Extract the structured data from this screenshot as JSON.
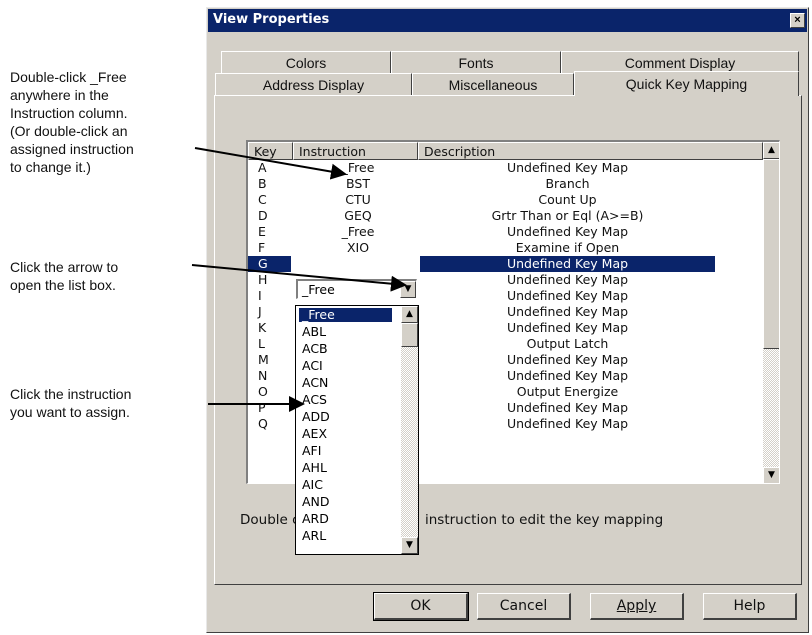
{
  "callouts": [
    {
      "lines": [
        "Double-click _Free",
        "anywhere in the",
        "Instruction column.",
        "(Or double-click an",
        "assigned instruction",
        "to change it.)"
      ]
    },
    {
      "lines": [
        "Click the arrow to",
        "open the list box."
      ]
    },
    {
      "lines": [
        "Click the instruction",
        "you want to assign."
      ]
    }
  ],
  "dialog": {
    "title": "View Properties",
    "close_label": "×",
    "tabs_back": [
      "Colors",
      "Fonts",
      "Comment Display"
    ],
    "tabs_front": [
      "Address Display",
      "Miscellaneous",
      "Quick Key Mapping"
    ],
    "active_tab": "Quick Key Mapping",
    "columns": [
      "Key",
      "Instruction",
      "Description"
    ],
    "rows": [
      {
        "key": "A",
        "instruction": "_Free",
        "description": "Undefined Key Map"
      },
      {
        "key": "B",
        "instruction": "BST",
        "description": "Branch"
      },
      {
        "key": "C",
        "instruction": "CTU",
        "description": "Count Up"
      },
      {
        "key": "D",
        "instruction": "GEQ",
        "description": "Grtr Than or Eql (A>=B)"
      },
      {
        "key": "E",
        "instruction": "_Free",
        "description": "Undefined Key Map"
      },
      {
        "key": "F",
        "instruction": "XIO",
        "description": "Examine if Open"
      },
      {
        "key": "G",
        "instruction": "",
        "description": "Undefined Key Map",
        "selected": true
      },
      {
        "key": "H",
        "instruction": "",
        "description": "Undefined Key Map"
      },
      {
        "key": "I",
        "instruction": "",
        "description": "Undefined Key Map"
      },
      {
        "key": "J",
        "instruction": "",
        "description": "Undefined Key Map"
      },
      {
        "key": "K",
        "instruction": "",
        "description": "Undefined Key Map"
      },
      {
        "key": "L",
        "instruction": "",
        "description": "Output Latch"
      },
      {
        "key": "M",
        "instruction": "",
        "description": "Undefined Key Map"
      },
      {
        "key": "N",
        "instruction": "",
        "description": "Undefined Key Map"
      },
      {
        "key": "O",
        "instruction": "",
        "description": "Output Energize"
      },
      {
        "key": "P",
        "instruction": "",
        "description": "Undefined Key Map"
      },
      {
        "key": "Q",
        "instruction": "",
        "description": "Undefined Key Map"
      }
    ],
    "combo_value": "_Free",
    "dropdown_options": [
      "_Free",
      "ABL",
      "ACB",
      "ACI",
      "ACN",
      "ACS",
      "ADD",
      "AEX",
      "AFI",
      "AHL",
      "AIC",
      "AND",
      "ARD",
      "ARL"
    ],
    "dropdown_selected": "_Free",
    "note_left": "Double c",
    "note_right": "instruction to edit the key mapping",
    "buttons": {
      "ok": "OK",
      "cancel": "Cancel",
      "apply": "Apply",
      "help": "Help"
    }
  },
  "colors": {
    "titlebar": "#0a246a",
    "face": "#d4d0c8",
    "selection": "#0a246a"
  },
  "icons": {
    "close": "close-icon",
    "scroll_up": "arrow-up-icon",
    "scroll_down": "arrow-down-icon",
    "dropdown": "chevron-down-icon"
  }
}
